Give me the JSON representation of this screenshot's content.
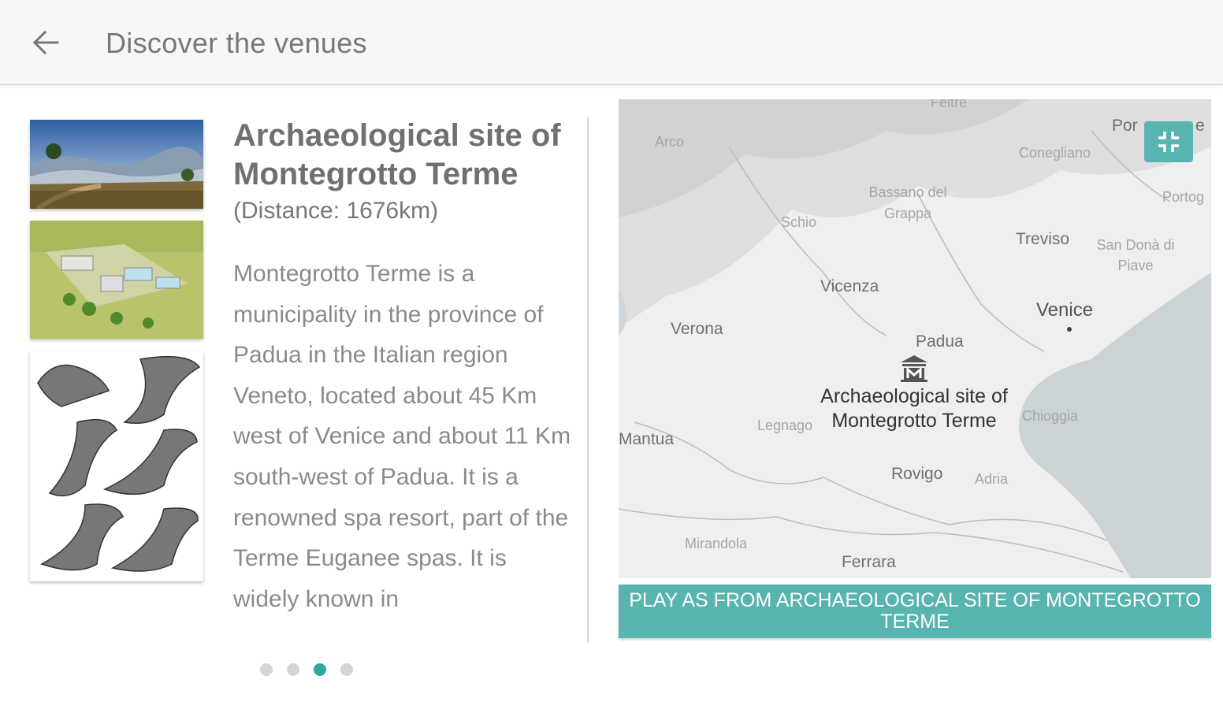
{
  "appbar": {
    "back_icon": "arrow-back-icon",
    "title": "Discover the venues"
  },
  "venue": {
    "title": "Archaeological site of Montegrotto Terme",
    "distance": "(Distance: 1676km)",
    "description": "Montegrotto Terme is a municipality in the province of Padua in the Italian region Veneto, located about 45 Km west of Venice and about 11 Km south-west of Padua. It is a renowned spa resort, part of the Terme Euganee spas. It is widely known in"
  },
  "map": {
    "labels": {
      "feltre": "Feltre",
      "arco": "Arco",
      "conegliano": "Conegliano",
      "bassano": "Bassano del Grappa",
      "schio": "Schio",
      "treviso": "Treviso",
      "san_dona": "San Donà di Piave",
      "portogruaro": "Portog",
      "pordenone": "Por",
      "pordenone_tail": "e",
      "vicenza": "Vicenza",
      "verona": "Verona",
      "venice": "Venice",
      "padua": "Padua",
      "legnago": "Legnago",
      "chioggia": "Chioggia",
      "mantua": "Mantua",
      "rovigo": "Rovigo",
      "adria": "Adria",
      "mirandola": "Mirandola",
      "ferrara": "Ferrara"
    },
    "marker_icon": "museum-icon",
    "marker_label": "Archaeological site of Montegrotto Terme",
    "collapse_icon": "fullscreen-exit-icon",
    "accent_color": "#58b4ae"
  },
  "play_button": {
    "label": "PLAY AS FROM ARCHAEOLOGICAL SITE OF MONTEGROTTO TERME"
  },
  "gallery": {
    "thumbnails": [
      "landscape-photo",
      "site-reconstruction-illustration",
      "drinking-horns-drawing"
    ],
    "page_count": 4,
    "active_page": 3
  },
  "colors": {
    "accent": "#58b4ae",
    "active_dot": "#2fa69e",
    "appbar_bg": "#f7f7f7"
  }
}
